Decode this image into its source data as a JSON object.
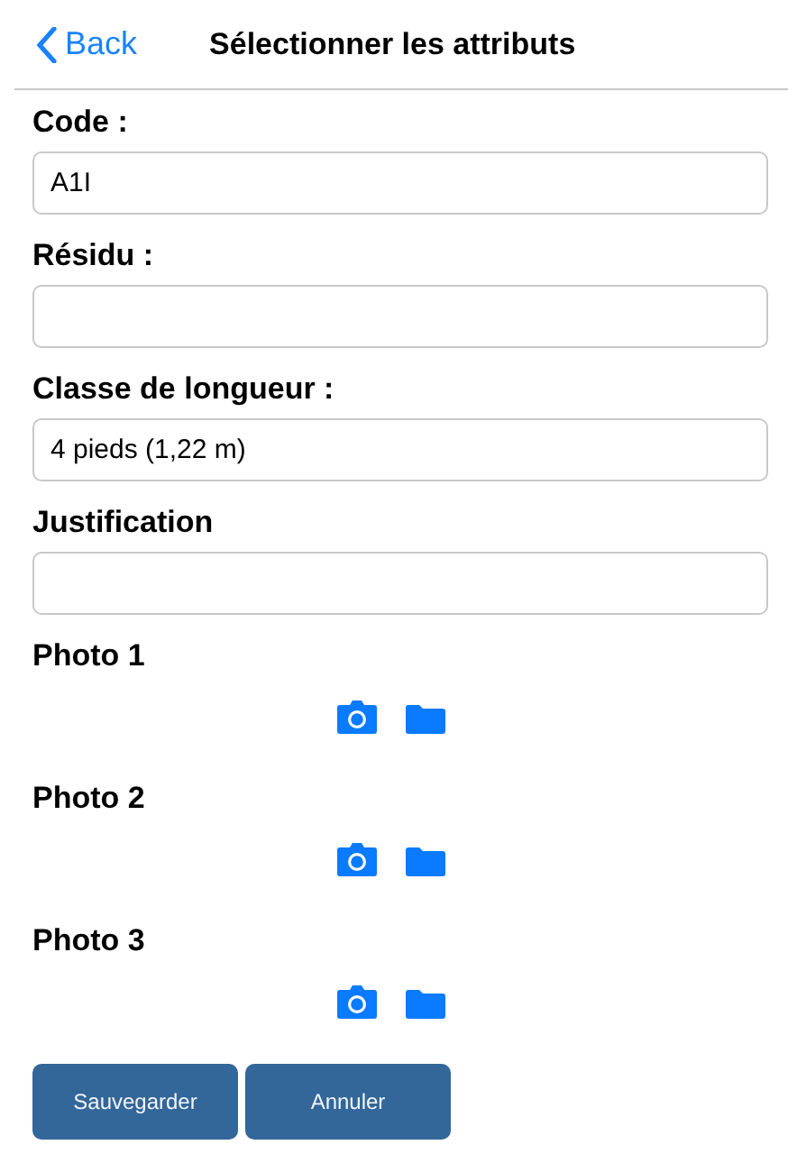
{
  "header": {
    "back": "Back",
    "title": "Sélectionner les attributs"
  },
  "fields": [
    {
      "label": "Code :",
      "value": "A1I"
    },
    {
      "label": "Résidu :"
    },
    {
      "label": "Classe de longueur :",
      "value": "4 pieds (1,22 m)"
    },
    {
      "label": "Justification"
    }
  ],
  "photos": [
    {
      "label": "Photo 1"
    },
    {
      "label": "Photo 2"
    },
    {
      "label": "Photo 3"
    }
  ],
  "buttons": [
    "Sauvegarder",
    "Annuler"
  ]
}
